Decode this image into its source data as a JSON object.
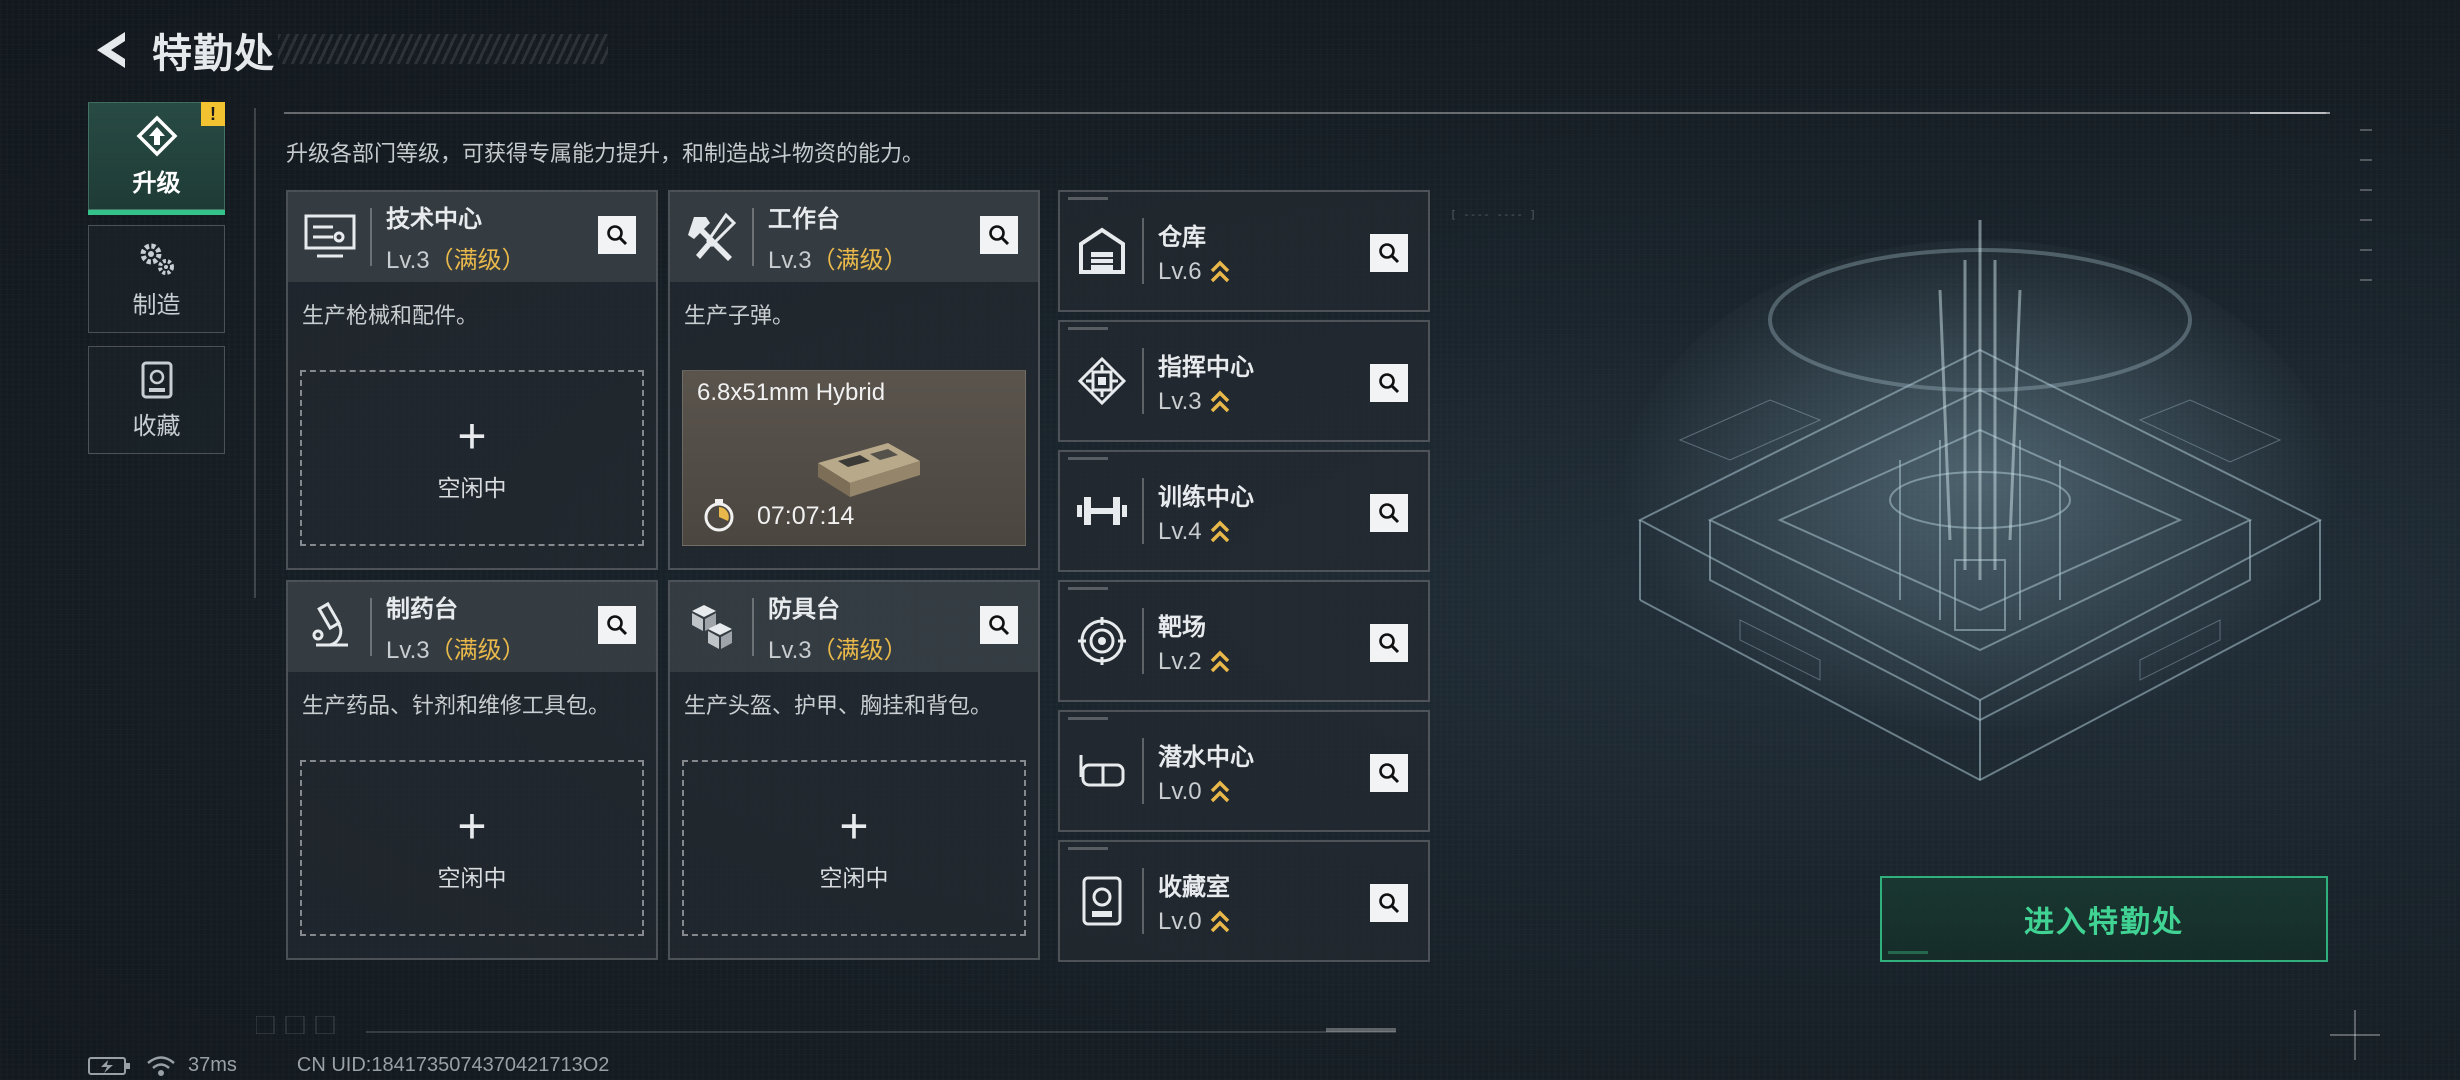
{
  "header": {
    "title": "特勤处",
    "back_icon": "back-arrow-icon"
  },
  "nav": [
    {
      "label": "升级",
      "icon": "upgrade-icon",
      "active": true,
      "alert": "!"
    },
    {
      "label": "制造",
      "icon": "gears-icon",
      "active": false
    },
    {
      "label": "收藏",
      "icon": "collection-icon",
      "active": false
    }
  ],
  "description": "升级各部门等级，可获得专属能力提升，和制造战斗物资的能力。",
  "facilities": [
    {
      "name": "技术中心",
      "level": "Lv.3",
      "max": "（满级）",
      "desc": "生产枪械和配件。",
      "slot": {
        "plus": "+",
        "state": "空闲中"
      }
    },
    {
      "name": "工作台",
      "level": "Lv.3",
      "max": "（满级）",
      "desc": "生产子弹。",
      "craft": {
        "item": "6.8x51mm Hybrid",
        "time": "07:07:14"
      }
    },
    {
      "name": "制药台",
      "level": "Lv.3",
      "max": "（满级）",
      "desc": "生产药品、针剂和维修工具包。",
      "slot": {
        "plus": "+",
        "state": "空闲中"
      }
    },
    {
      "name": "防具台",
      "level": "Lv.3",
      "max": "（满级）",
      "desc": "生产头盔、护甲、胸挂和背包。",
      "slot": {
        "plus": "+",
        "state": "空闲中"
      }
    }
  ],
  "departments": [
    {
      "name": "仓库",
      "level": "Lv.6",
      "icon": "warehouse-icon"
    },
    {
      "name": "指挥中心",
      "level": "Lv.3",
      "icon": "chip-icon"
    },
    {
      "name": "训练中心",
      "level": "Lv.4",
      "icon": "dumbbell-icon"
    },
    {
      "name": "靶场",
      "level": "Lv.2",
      "icon": "target-icon"
    },
    {
      "name": "潜水中心",
      "level": "Lv.0",
      "icon": "diving-mask-icon"
    },
    {
      "name": "收藏室",
      "level": "Lv.0",
      "icon": "trophy-case-icon"
    }
  ],
  "enter_button": "进入特勤处",
  "status": {
    "ping": "37ms",
    "uid": "CN UID:1841735074370421713O2"
  },
  "colors": {
    "accent_green": "#33c38a",
    "max_level": "#e8b84a",
    "alert": "#f2c230"
  }
}
